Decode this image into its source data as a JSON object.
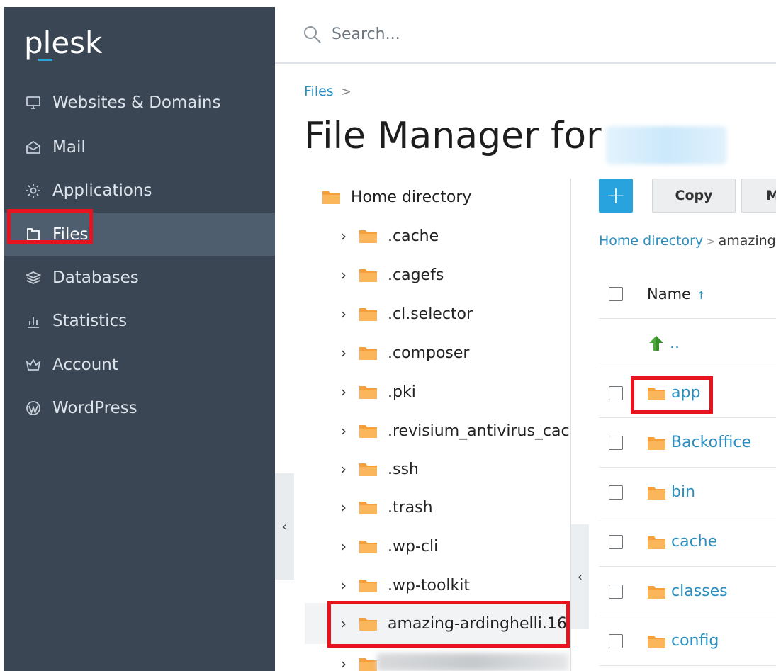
{
  "brand": {
    "logo_text": "plesk",
    "accent": "#2aa6d9",
    "sidebar_bg": "#3a4654",
    "highlight": "#e8131f"
  },
  "sidebar": {
    "items": [
      {
        "label": "Websites & Domains",
        "icon": "monitor-icon"
      },
      {
        "label": "Mail",
        "icon": "mail-icon"
      },
      {
        "label": "Applications",
        "icon": "gear-icon"
      },
      {
        "label": "Files",
        "icon": "folder-outline-icon",
        "active": true
      },
      {
        "label": "Databases",
        "icon": "stack-icon"
      },
      {
        "label": "Statistics",
        "icon": "bar-chart-icon"
      },
      {
        "label": "Account",
        "icon": "crown-icon"
      },
      {
        "label": "WordPress",
        "icon": "wordpress-icon"
      }
    ]
  },
  "header": {
    "search_placeholder": "Search..."
  },
  "breadcrumb": {
    "root": "Files",
    "separator": ">"
  },
  "page": {
    "title": "File Manager for"
  },
  "tree": {
    "root": "Home directory",
    "items": [
      ".cache",
      ".cagefs",
      ".cl.selector",
      ".composer",
      ".pki",
      ".revisium_antivirus_cach",
      ".ssh",
      ".trash",
      ".wp-cli",
      ".wp-toolkit",
      "amazing-ardinghelli.16"
    ]
  },
  "toolbar": {
    "add_label": "+",
    "copy_label": "Copy",
    "move_label": "M"
  },
  "path": {
    "root": "Home directory",
    "separator": ">",
    "current": "amazing"
  },
  "file_list": {
    "header": {
      "name": "Name",
      "sort": "↑"
    },
    "parent": "..",
    "items": [
      "app",
      "Backoffice",
      "bin",
      "cache",
      "classes",
      "config"
    ]
  },
  "collapse_glyph": "‹"
}
